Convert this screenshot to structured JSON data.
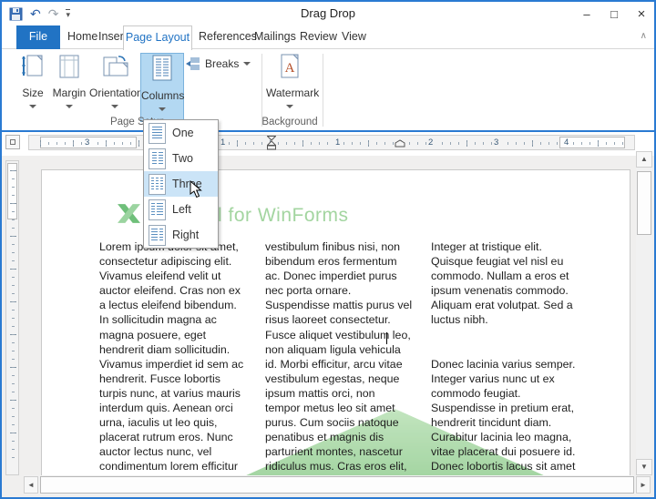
{
  "titlebar": {
    "title": "Drag Drop",
    "minimize": "–",
    "maximize": "□",
    "close": "×"
  },
  "qat": {
    "undo": "↶",
    "redo": "↷",
    "more": "▾"
  },
  "tabs": {
    "file": "File",
    "items": [
      "Home",
      "Insert",
      "Page Layout",
      "References",
      "Mailings",
      "Review",
      "View"
    ],
    "selected": "Page Layout",
    "collapse": "∧"
  },
  "ribbon": {
    "size": "Size",
    "margin": "Margin",
    "orientation": "Orientation",
    "columns": "Columns",
    "breaks": "Breaks",
    "watermark": "Watermark",
    "group_page_setup": "Page Setup",
    "group_background": "Background"
  },
  "columns_menu": {
    "items": [
      {
        "label": "One"
      },
      {
        "label": "Two"
      },
      {
        "label": "Three"
      },
      {
        "label": "Left"
      },
      {
        "label": "Right"
      }
    ],
    "highlighted": "Three"
  },
  "ruler": {
    "numbers": [
      "3",
      "1",
      "1",
      "2",
      "3",
      "4"
    ]
  },
  "scrollbar": {
    "up": "▲",
    "down": "▼",
    "left": "◄",
    "right": "►"
  },
  "document": {
    "heading": "l for WinForms",
    "column1": "Lorem ipsum dolor sit amet,\nconsectetur adipiscing elit.\nVivamus eleifend velit ut\nauctor eleifend. Cras non ex\na lectus eleifend bibendum.\nIn sollicitudin magna ac\nmagna posuere, eget\nhendrerit diam sollicitudin.\nVivamus imperdiet id sem ac\nhendrerit. Fusce lobortis\nturpis nunc, at varius mauris\ninterdum quis. Aenean orci\nurna, iaculis ut leo quis,\nplacerat rutrum eros. Nunc\nauctor lectus nunc, vel\ncondimentum lorem efficitur\nvel. Donec vel nulla metus.",
    "column2": "vestibulum finibus nisi, non\nbibendum eros fermentum\nac. Donec imperdiet purus\nnec porta ornare.\nSuspendisse mattis purus vel\nrisus laoreet consectetur.\nFusce aliquet vestibulum leo,\nnon aliquam ligula vehicula\nid. Morbi efficitur, arcu vitae\nvestibulum egestas, neque\nipsum mattis orci, non\ntempor metus leo sit amet\npurus. Cum sociis natoque\npenatibus et magnis dis\nparturient montes, nascetur\nridiculus mus. Cras eros elit,\nmolestie mollis iaculis in",
    "column3": "Integer at tristique elit.\nQuisque feugiat vel nisl eu\ncommodo. Nullam a eros et\nipsum venenatis commodo.\nAliquam erat volutpat. Sed a\nluctus nibh.\n\n\nDonec lacinia varius semper.\nInteger varius nunc ut ex\ncommodo feugiat.\nSuspendisse in pretium erat,\nhendrerit tincidunt diam.\nCurabitur lacinia leo magna,\nvitae placerat dui posuere id.\nDonec lobortis lacus sit amet\nultrices gravida. Praesent"
  },
  "colors": {
    "accent_blue": "#2173c4",
    "window_border": "#2a7ad2",
    "columns_button_highlight": "#b3d8f2",
    "menu_highlight": "#cbe4f7",
    "heading_green": "#a3d5a0",
    "watermark_green": "#8fcb8e"
  }
}
